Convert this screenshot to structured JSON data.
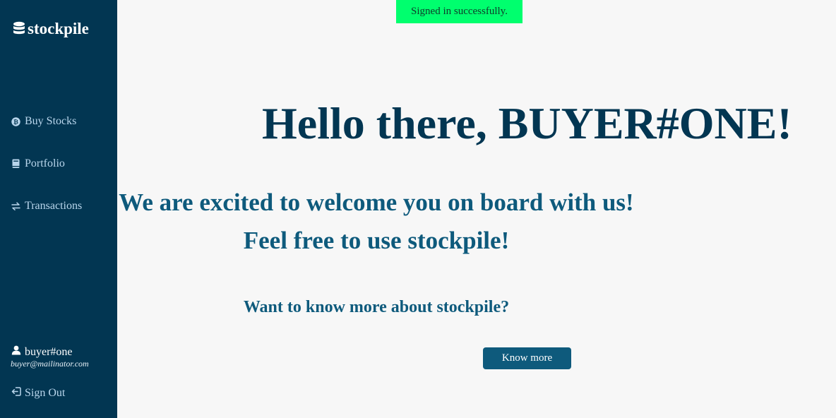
{
  "app": {
    "brand": "stockpile",
    "icons": {
      "brand": "database-icon",
      "buy": "coin-icon",
      "portfolio": "book-icon",
      "transactions": "exchange-arrows-icon",
      "user": "user-icon",
      "signout": "sign-out-icon"
    },
    "colors": {
      "sidebar_bg": "#023652",
      "nav_text": "#b9d6ec",
      "heading": "#023652",
      "subheading": "#0e5a7c",
      "toast_bg": "#00ff6e",
      "button_bg": "#0e5a7c",
      "page_bg": "#f7f7f7"
    }
  },
  "sidebar": {
    "items": [
      {
        "label": "Buy Stocks"
      },
      {
        "label": "Portfolio"
      },
      {
        "label": "Transactions"
      }
    ],
    "user": {
      "name": "buyer#one",
      "email": "buyer@mailinator.com"
    },
    "signout_label": "Sign Out"
  },
  "toast": {
    "message": "Signed in successfully."
  },
  "main": {
    "greeting": "Hello there, BUYER#ONE!",
    "welcome_line1": "We are excited to welcome you on board with us!",
    "welcome_line2": "Feel free to use stockpile!",
    "question": "Want to know more about stockpile?",
    "button_label": "Know more"
  }
}
